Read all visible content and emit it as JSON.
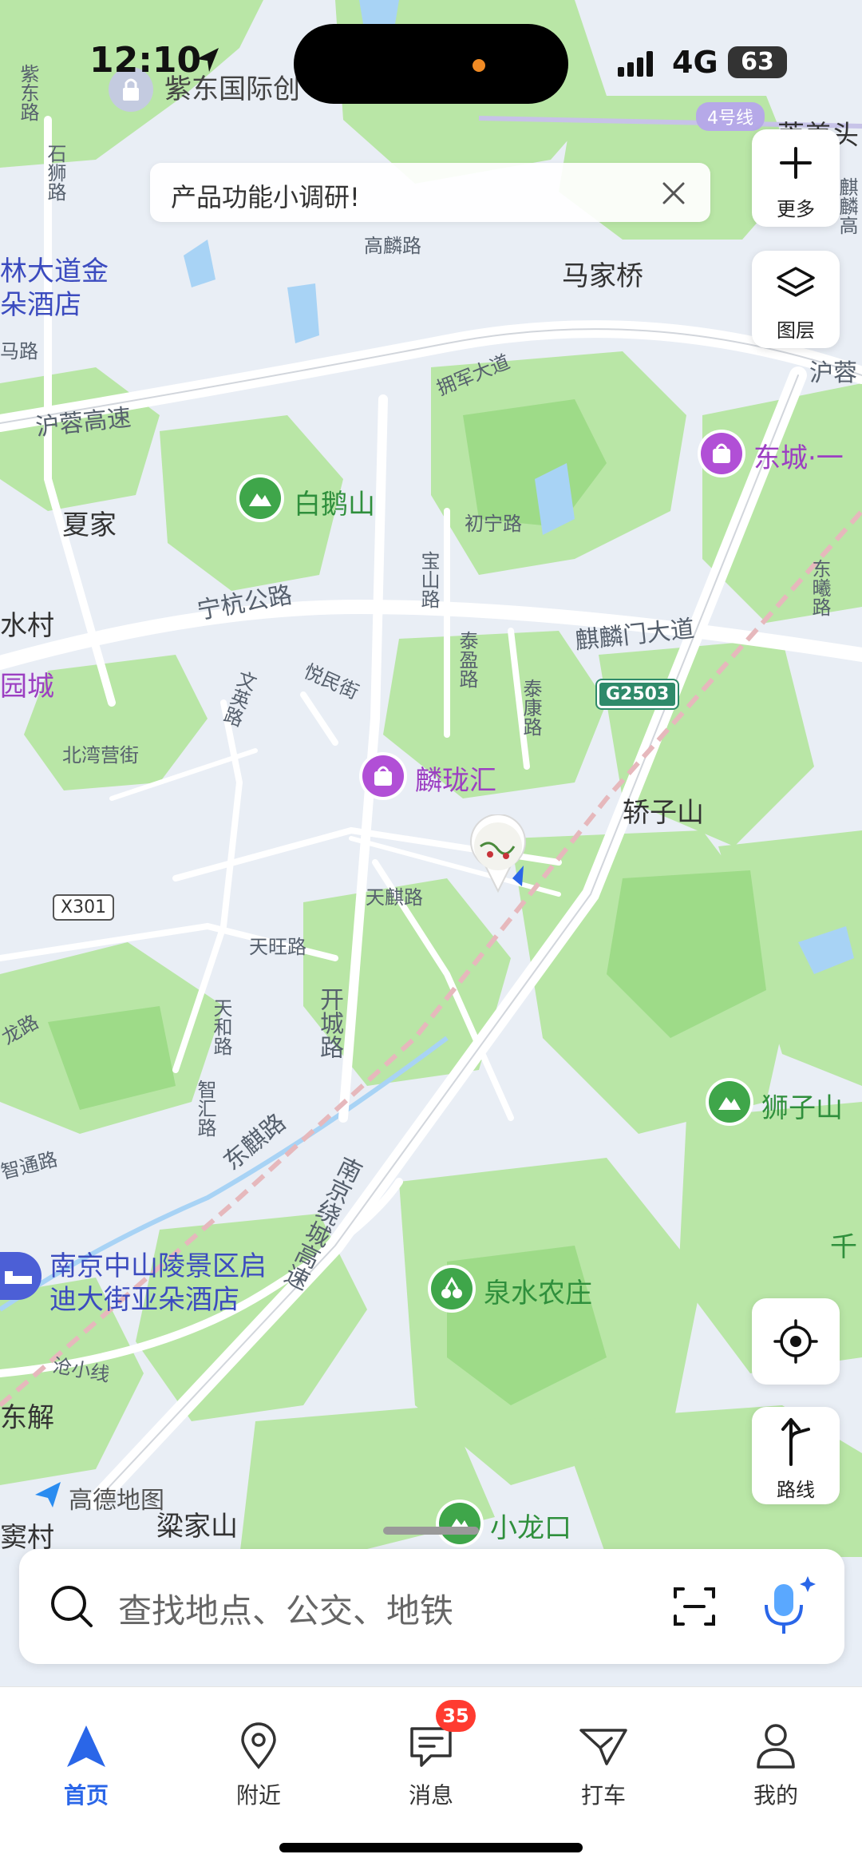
{
  "status_bar": {
    "time": "12:10",
    "network": "4G",
    "battery": "63"
  },
  "survey_banner": {
    "text": "产品功能小调研!"
  },
  "side_buttons": {
    "more_label": "更多",
    "layers_label": "图层",
    "route_label": "路线"
  },
  "map": {
    "places": {
      "zidong": "紫东国际创",
      "majiaqiao": "马家桥",
      "xiajia": "夏家",
      "shuicun": "水村",
      "yuancheng": "园城",
      "jiaozishan": "轿子山",
      "liujiashan": "粱家山",
      "dongjie": "东解",
      "doucun": "窦村",
      "qian": "千",
      "pushan": "菩姜头",
      "dongchengyi": "东城·一"
    },
    "pois": {
      "baieshan": "白鹅山",
      "linlonghui": "麟珑汇",
      "shizishan": "狮子山",
      "quanshuinongzhuang": "泉水农庄",
      "xiaolongkou": "小龙口",
      "dongcheng": "东城·一",
      "hotel_top_line1": "林大道金",
      "hotel_top_line2": "朵酒店",
      "hotel_bottom_line1": "南京中山陵景区启",
      "hotel_bottom_line2": "迪大街亚朵酒店",
      "gaode": "高德地图"
    },
    "roads": {
      "hurong": "沪蓉高速",
      "hurong_right": "沪蓉",
      "ninghang": "宁杭公路",
      "qilinmen": "麒麟门大道",
      "gaolin": "高麟路",
      "yongjun": "拥军大道",
      "chuning": "初宁路",
      "baoshan": "宝山路",
      "taiying": "泰盈路",
      "taikang": "泰康路",
      "yuemin": "悦民街",
      "wenying": "文英路",
      "beiwanying": "北湾营街",
      "tianqi": "天麒路",
      "tianwang": "天旺路",
      "kaicheng": "开城路",
      "tianhe": "天和路",
      "zhihui": "智汇路",
      "zhitong": "智通路",
      "dongqi": "东麒路",
      "raocheng": "南京绕城高速",
      "canghu": "沧小线",
      "shishi": "石狮路",
      "zidong_road": "紫东路",
      "ma": "马路",
      "longpark": "龙路",
      "dongxi": "东曦路",
      "qilin_hi": "麒麟高",
      "line4": "4号线",
      "g2503": "G2503",
      "x301": "X301"
    }
  },
  "search": {
    "placeholder": "查找地点、公交、地铁"
  },
  "tabs": [
    {
      "label": "首页",
      "active": true
    },
    {
      "label": "附近",
      "active": false
    },
    {
      "label": "消息",
      "active": false,
      "badge": "35"
    },
    {
      "label": "打车",
      "active": false
    },
    {
      "label": "我的",
      "active": false
    }
  ],
  "colors": {
    "accent": "#2a66e8",
    "forest": "#b8e6a4",
    "forest_dark": "#9ddc86",
    "water": "#a9d4f6",
    "road": "#ffffff",
    "badge": "#ff3b30"
  }
}
